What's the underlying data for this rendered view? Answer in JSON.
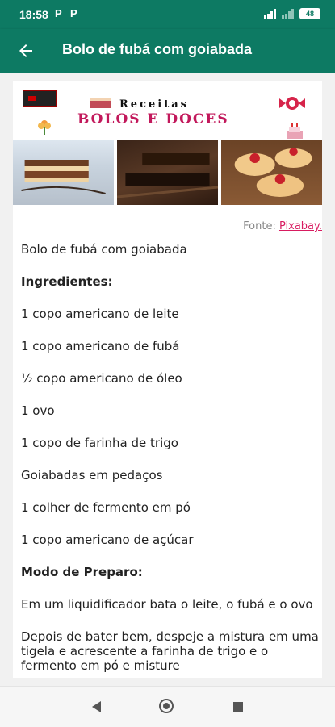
{
  "status": {
    "time": "18:58",
    "notif1": "P",
    "notif2": "P",
    "battery": "48"
  },
  "appbar": {
    "title": "Bolo de fubá com goiabada"
  },
  "banner": {
    "line1": "Receitas",
    "line2": "BOLOS E DOCES"
  },
  "source": {
    "label": "Fonte:",
    "link": "Pixabay."
  },
  "recipe": {
    "lines": [
      "Bolo de fubá com goiabada",
      "Ingredientes:",
      "1 copo americano de leite",
      "1 copo americano de fubá",
      "½ copo americano de óleo",
      "1 ovo",
      "1 copo de farinha de trigo",
      "Goiabadas em pedaços",
      "1 colher de fermento em pó",
      "1 copo americano de açúcar",
      "Modo de Preparo:",
      "Em um liquidificador bata o leite, o fubá e o ovo",
      "Depois de bater bem, despeje a mistura em uma tigela e acrescente a farinha de trigo e o fermento em pó e misture"
    ]
  }
}
